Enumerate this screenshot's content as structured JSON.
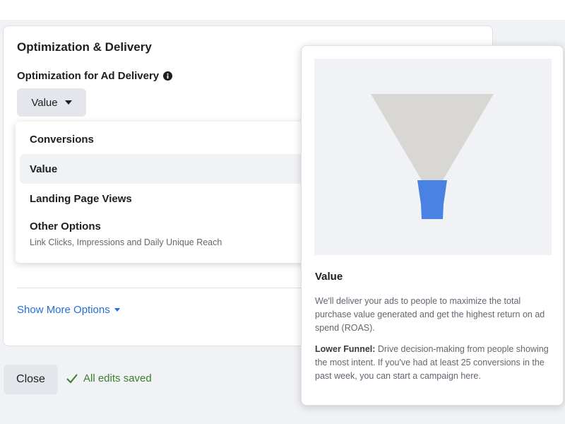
{
  "section": {
    "title": "Optimization & Delivery",
    "field_label": "Optimization for Ad Delivery",
    "dropdown_value": "Value"
  },
  "menu": {
    "items": [
      {
        "label": "Conversions",
        "selected": false
      },
      {
        "label": "Value",
        "selected": true
      },
      {
        "label": "Landing Page Views",
        "selected": false
      },
      {
        "label": "Other Options",
        "sublabel": "Link Clicks, Impressions and Daily Unique Reach",
        "selected": false
      }
    ]
  },
  "show_more": "Show More Options",
  "footer": {
    "close_label": "Close",
    "saved_status": "All edits saved"
  },
  "info_panel": {
    "title": "Value",
    "description": "We'll deliver your ads to people to maximize the total purchase value generated and get the highest return on ad spend (ROAS).",
    "funnel_label": "Lower Funnel:",
    "funnel_text": " Drive decision-making from people showing the most intent. If you've had at least 25 conversions in the past week, you can start a campaign here."
  },
  "colors": {
    "funnel_top": "#d9d7d3",
    "funnel_bottom": "#4a82e4",
    "link_blue": "#216fdb",
    "saved_green": "#3a7f2d"
  },
  "icons": [
    "info-icon",
    "caret-down-icon",
    "checkmark-icon"
  ]
}
